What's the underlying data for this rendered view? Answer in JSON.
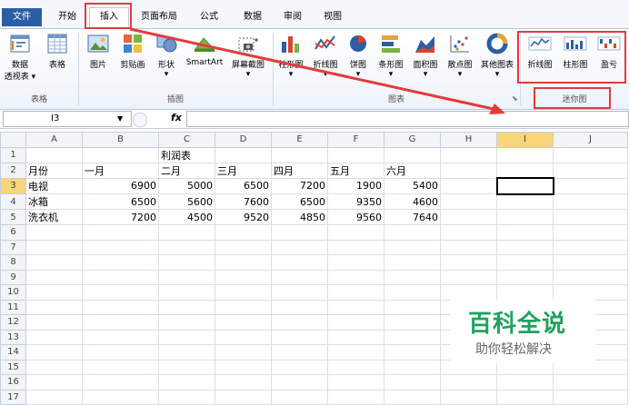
{
  "tabs": [
    "文件",
    "开始",
    "插入",
    "页面布局",
    "公式",
    "数据",
    "审阅",
    "视图"
  ],
  "ribbon": {
    "buttons": [
      {
        "l1": "数据",
        "l2": "透视表 ▾"
      },
      {
        "l1": "表格",
        "l2": ""
      },
      {
        "l1": "图片",
        "l2": ""
      },
      {
        "l1": "剪贴画",
        "l2": ""
      },
      {
        "l1": "形状",
        "l2": "▾"
      },
      {
        "l1": "SmartArt",
        "l2": ""
      },
      {
        "l1": "屏幕截图",
        "l2": "▾"
      },
      {
        "l1": "柱形图",
        "l2": "▾"
      },
      {
        "l1": "折线图",
        "l2": "▾"
      },
      {
        "l1": "饼图",
        "l2": "▾"
      },
      {
        "l1": "条形图",
        "l2": "▾"
      },
      {
        "l1": "面积图",
        "l2": "▾"
      },
      {
        "l1": "散点图",
        "l2": "▾"
      },
      {
        "l1": "其他图表",
        "l2": "▾"
      },
      {
        "l1": "折线图",
        "l2": ""
      },
      {
        "l1": "柱形图",
        "l2": ""
      },
      {
        "l1": "盈亏",
        "l2": ""
      }
    ],
    "groups": [
      "表格",
      "插图",
      "图表",
      "迷你图"
    ]
  },
  "formula": {
    "cell_ref": "I3",
    "fx": "fx",
    "value": ""
  },
  "columns": [
    "A",
    "B",
    "C",
    "D",
    "E",
    "F",
    "G",
    "H",
    "I",
    "J"
  ],
  "rows": [
    [
      "",
      "",
      "利润表",
      "",
      "",
      "",
      "",
      "",
      "",
      ""
    ],
    [
      "月份",
      "一月",
      "二月",
      "三月",
      "四月",
      "五月",
      "六月",
      "",
      "",
      ""
    ],
    [
      "电视",
      "6900",
      "5000",
      "6500",
      "7200",
      "1900",
      "5400",
      "",
      "",
      ""
    ],
    [
      "冰箱",
      "6500",
      "5600",
      "7600",
      "6500",
      "9350",
      "4600",
      "",
      "",
      ""
    ],
    [
      "洗衣机",
      "7200",
      "4500",
      "9520",
      "4850",
      "9560",
      "7640",
      "",
      "",
      ""
    ],
    [
      "",
      "",
      "",
      "",
      "",
      "",
      "",
      "",
      "",
      ""
    ],
    [
      "",
      "",
      "",
      "",
      "",
      "",
      "",
      "",
      "",
      ""
    ],
    [
      "",
      "",
      "",
      "",
      "",
      "",
      "",
      "",
      "",
      ""
    ],
    [
      "",
      "",
      "",
      "",
      "",
      "",
      "",
      "",
      "",
      ""
    ],
    [
      "",
      "",
      "",
      "",
      "",
      "",
      "",
      "",
      "",
      ""
    ],
    [
      "",
      "",
      "",
      "",
      "",
      "",
      "",
      "",
      "",
      ""
    ],
    [
      "",
      "",
      "",
      "",
      "",
      "",
      "",
      "",
      "",
      ""
    ],
    [
      "",
      "",
      "",
      "",
      "",
      "",
      "",
      "",
      "",
      ""
    ],
    [
      "",
      "",
      "",
      "",
      "",
      "",
      "",
      "",
      "",
      ""
    ],
    [
      "",
      "",
      "",
      "",
      "",
      "",
      "",
      "",
      "",
      ""
    ],
    [
      "",
      "",
      "",
      "",
      "",
      "",
      "",
      "",
      "",
      ""
    ],
    [
      "",
      "",
      "",
      "",
      "",
      "",
      "",
      "",
      "",
      ""
    ]
  ],
  "watermark": {
    "title": "百科全说",
    "subtitle": "助你轻松解决"
  },
  "colors": {
    "accent": "#2c5ea3",
    "highlight": "#e33b3b",
    "brand": "#1fa35c"
  }
}
